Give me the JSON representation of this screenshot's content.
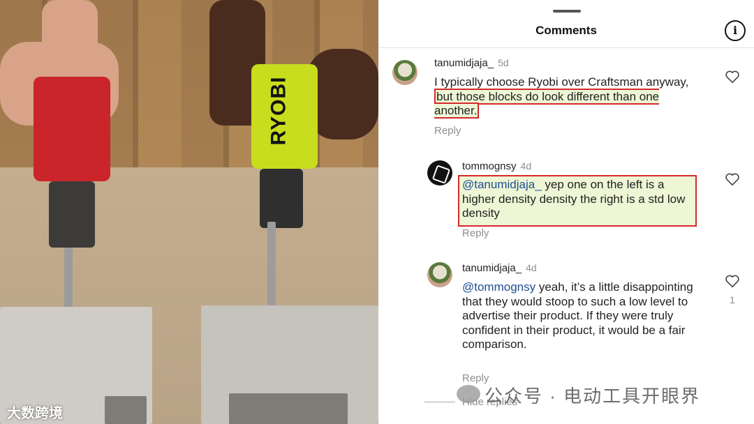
{
  "panel": {
    "title": "Comments",
    "info_icon": "info-icon"
  },
  "comments": [
    {
      "user": "tanumidjaja_",
      "age": "5d",
      "text_plain": "I typically choose Ryobi over Craftsman anyway, ",
      "text_highlight": "but those blocks do look different than one another.",
      "reply_label": "Reply"
    },
    {
      "user": "tommognsy",
      "age": "4d",
      "mention": "@tanumidjaja_",
      "text": " yep one on the left is a higher density density the right is a std low density",
      "reply_label": "Reply"
    },
    {
      "user": "tanumidjaja_",
      "age": "4d",
      "mention": "@tommognsy",
      "text": " yeah, it’s a little disappointing that they would stoop to such a low level to advertise their product. If they were truly confident in their product, it would be a fair comparison.",
      "reply_label": "Reply",
      "likes": "1"
    }
  ],
  "hide_replies": "Hide replies",
  "watermark_right": "公众号 · 电动工具开眼界",
  "watermark_left": "大数跨境",
  "video_brand": "RYOBI",
  "colors": {
    "highlight_border": "#d42a2a",
    "highlight_fill": "#eef6d6",
    "mention": "#1f4f8f"
  }
}
